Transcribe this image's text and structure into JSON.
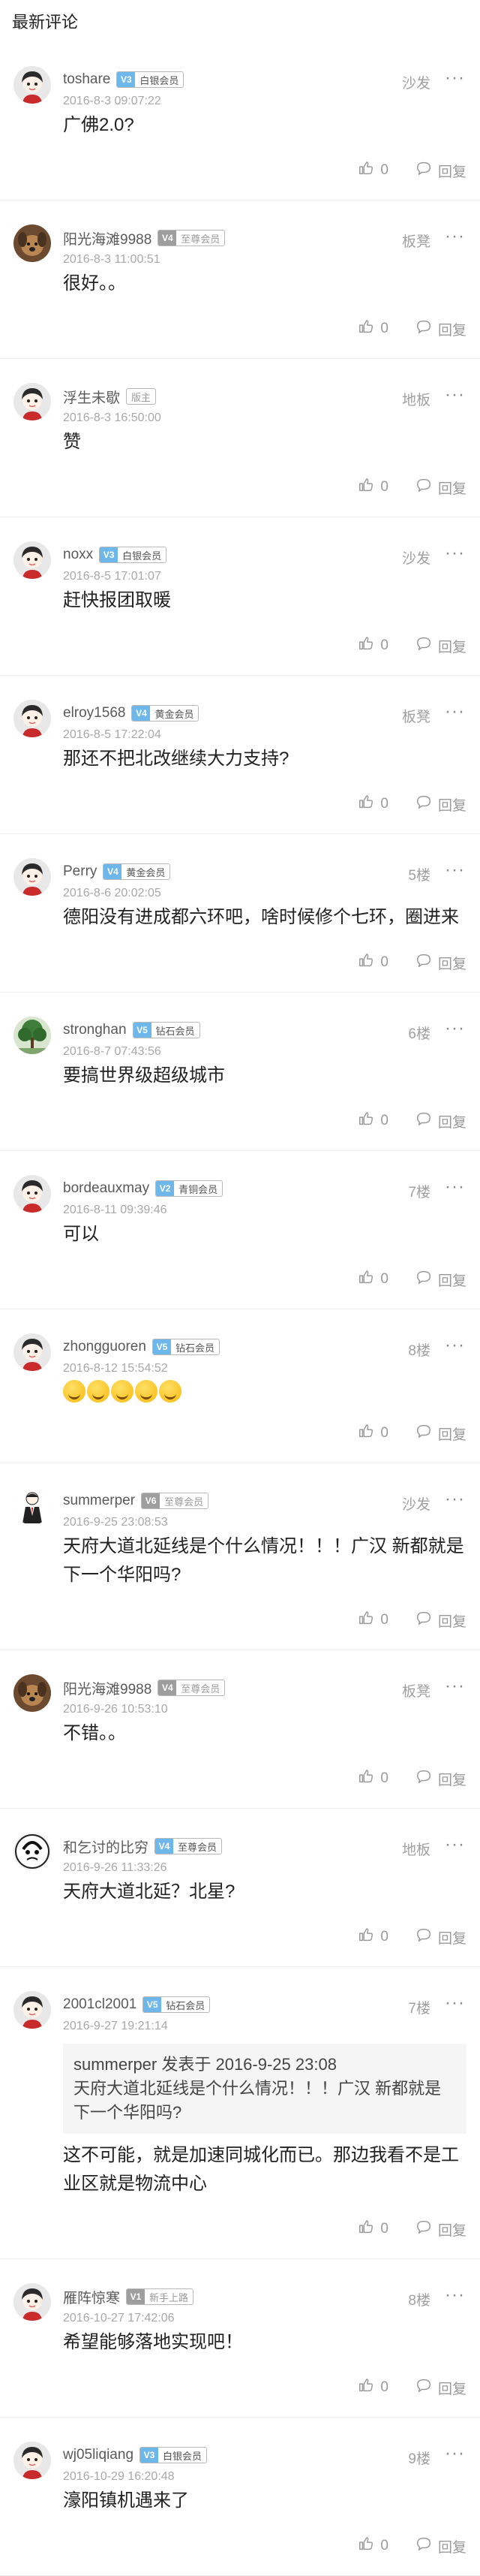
{
  "section_title": "最新评论",
  "like_label": "0",
  "reply_label": "回复",
  "comments": [
    {
      "user": "toshare",
      "vip_level": "V3",
      "vip_tier": "白银会员",
      "vip_grey": false,
      "time": "2016-8-3 09:07:22",
      "floor": "沙发",
      "content": "广佛2.0?",
      "avatar": "avatar-face"
    },
    {
      "user": "阳光海滩9988",
      "vip_level": "V4",
      "vip_tier": "至尊会员",
      "vip_grey": true,
      "time": "2016-8-3 11:00:51",
      "floor": "板凳",
      "content": "很好。。",
      "avatar": "avatar-dog"
    },
    {
      "user": "浮生未歇",
      "vip_level": "",
      "vip_tier": "版主",
      "vip_grey": true,
      "time": "2016-8-3 16:50:00",
      "floor": "地板",
      "content": "赞",
      "avatar": "avatar-face"
    },
    {
      "user": "noxx",
      "vip_level": "V3",
      "vip_tier": "白银会员",
      "vip_grey": false,
      "time": "2016-8-5 17:01:07",
      "floor": "沙发",
      "content": "赶快报团取暖",
      "avatar": "avatar-face"
    },
    {
      "user": "elroy1568",
      "vip_level": "V4",
      "vip_tier": "黄金会员",
      "vip_grey": false,
      "time": "2016-8-5 17:22:04",
      "floor": "板凳",
      "content": "那还不把北改继续大力支持?",
      "avatar": "avatar-face"
    },
    {
      "user": "Perry",
      "vip_level": "V4",
      "vip_tier": "黄金会员",
      "vip_grey": false,
      "time": "2016-8-6 20:02:05",
      "floor": "5楼",
      "content": "德阳没有进成都六环吧，啥时候修个七环，圈进来",
      "avatar": "avatar-face"
    },
    {
      "user": "stronghan",
      "vip_level": "V5",
      "vip_tier": "钻石会员",
      "vip_grey": false,
      "time": "2016-8-7 07:43:56",
      "floor": "6楼",
      "content": "要搞世界级超级城市",
      "avatar": "avatar-tree"
    },
    {
      "user": "bordeauxmay",
      "vip_level": "V2",
      "vip_tier": "青铜会员",
      "vip_grey": false,
      "time": "2016-8-11 09:39:46",
      "floor": "7楼",
      "content": "可以",
      "avatar": "avatar-face"
    },
    {
      "user": "zhongguoren",
      "vip_level": "V5",
      "vip_tier": "钻石会员",
      "vip_grey": false,
      "time": "2016-8-12 15:54:52",
      "floor": "8楼",
      "content": "",
      "emojis": 5,
      "avatar": "avatar-face"
    },
    {
      "user": "summerper",
      "vip_level": "V6",
      "vip_tier": "至尊会员",
      "vip_grey": true,
      "time": "2016-9-25 23:08:53",
      "floor": "沙发",
      "content": "天府大道北延线是个什么情况！！！广汉 新都就是下一个华阳吗?",
      "avatar": "avatar-suit"
    },
    {
      "user": "阳光海滩9988",
      "vip_level": "V4",
      "vip_tier": "至尊会员",
      "vip_grey": true,
      "time": "2016-9-26 10:53:10",
      "floor": "板凳",
      "content": "不错。。",
      "avatar": "avatar-dog"
    },
    {
      "user": "和乞讨的比穷",
      "vip_level": "V4",
      "vip_tier": "至尊会员",
      "vip_grey": false,
      "time": "2016-9-26 11:33:26",
      "floor": "地板",
      "content": "天府大道北延？北星?",
      "avatar": "avatar-sketch"
    },
    {
      "user": "2001cl2001",
      "vip_level": "V5",
      "vip_tier": "钻石会员",
      "vip_grey": false,
      "time": "2016-9-27 19:21:14",
      "floor": "7楼",
      "quote_head": "summerper 发表于 2016-9-25 23:08",
      "quote_body": "天府大道北延线是个什么情况！！！广汉 新都就是下一个华阳吗?",
      "content": "这不可能，就是加速同城化而已。那边我看不是工业区就是物流中心",
      "avatar": "avatar-face"
    },
    {
      "user": "雁阵惊寒",
      "vip_level": "V1",
      "vip_tier": "新手上路",
      "vip_grey": true,
      "time": "2016-10-27 17:42:06",
      "floor": "8楼",
      "content": "希望能够落地实现吧！",
      "avatar": "avatar-face"
    },
    {
      "user": "wj05liqiang",
      "vip_level": "V3",
      "vip_tier": "白银会员",
      "vip_grey": false,
      "time": "2016-10-29 16:20:48",
      "floor": "9楼",
      "content": "濠阳镇机遇来了",
      "avatar": "avatar-face"
    }
  ]
}
